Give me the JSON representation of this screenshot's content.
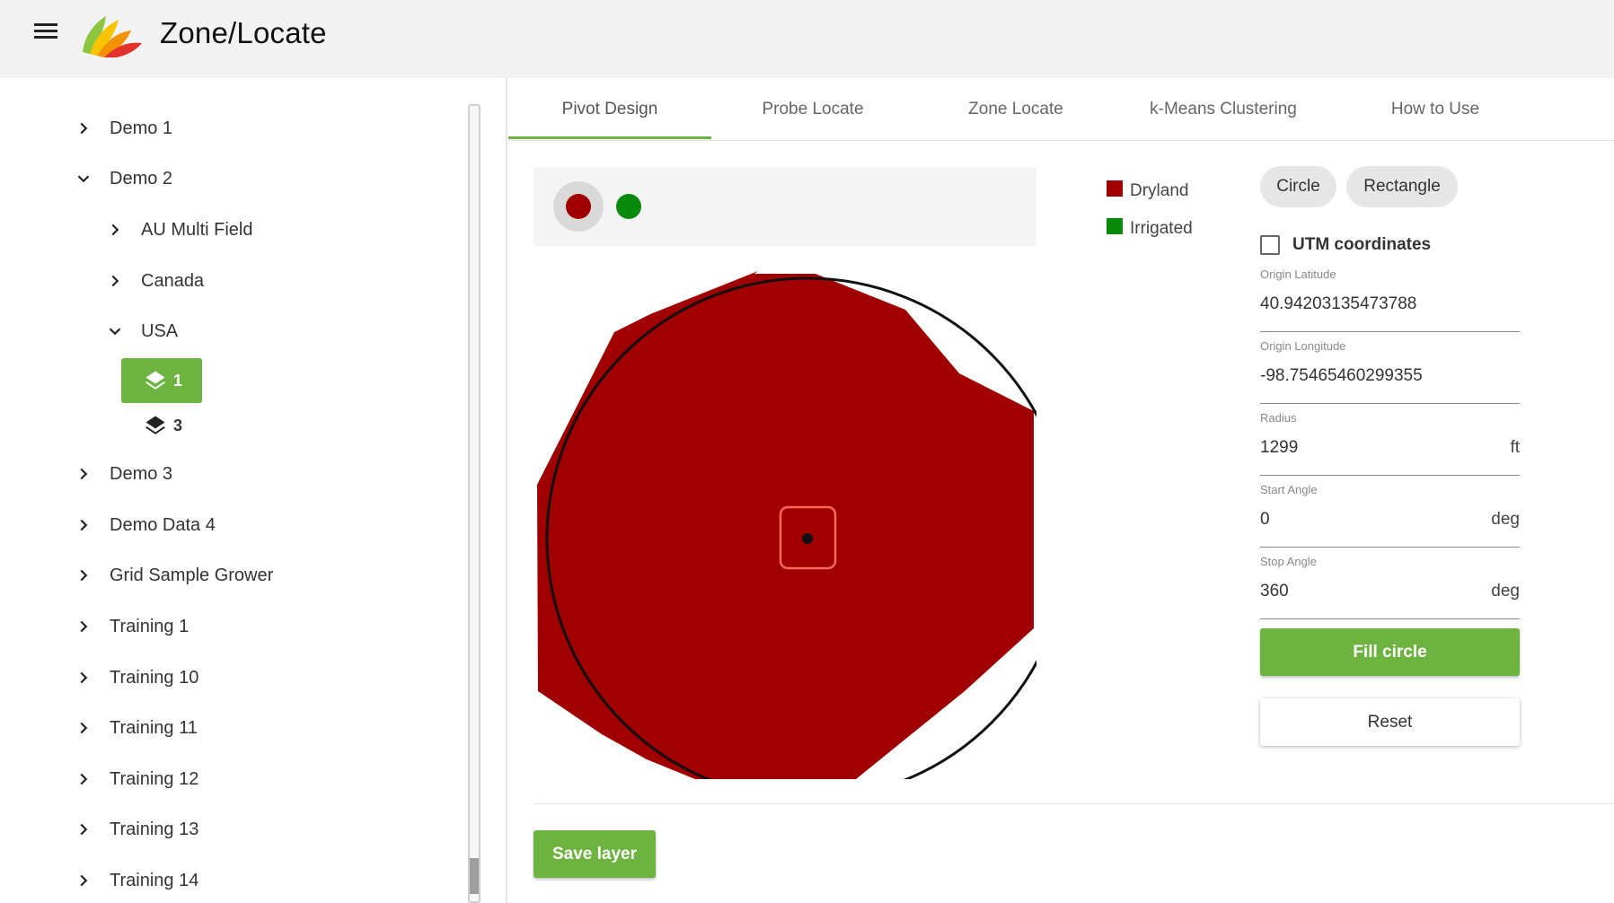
{
  "app": {
    "title": "Zone/Locate",
    "menu_icon": "hamburger-menu-icon",
    "logo_icon": "leaf-fan-logo-icon"
  },
  "sidebar": {
    "items": [
      {
        "label": "Demo 1",
        "expanded": false
      },
      {
        "label": "Demo 2",
        "expanded": true
      },
      {
        "label": "AU Multi Field",
        "expanded": false
      },
      {
        "label": "Canada",
        "expanded": false
      },
      {
        "label": "USA",
        "expanded": true
      },
      {
        "label": "1",
        "selected": true,
        "icon": "layers-icon"
      },
      {
        "label": "3",
        "selected": false,
        "icon": "layers-icon"
      },
      {
        "label": "Demo 3",
        "expanded": false
      },
      {
        "label": "Demo Data 4",
        "expanded": false
      },
      {
        "label": "Grid Sample Grower",
        "expanded": false
      },
      {
        "label": "Training 1",
        "expanded": false
      },
      {
        "label": "Training 10",
        "expanded": false
      },
      {
        "label": "Training 11",
        "expanded": false
      },
      {
        "label": "Training 12",
        "expanded": false
      },
      {
        "label": "Training 13",
        "expanded": false
      },
      {
        "label": "Training 14",
        "expanded": false
      }
    ]
  },
  "tabs": [
    {
      "label": "Pivot Design",
      "active": true
    },
    {
      "label": "Probe Locate",
      "active": false
    },
    {
      "label": "Zone Locate",
      "active": false
    },
    {
      "label": "k-Means Clustering",
      "active": false
    },
    {
      "label": "How to Use",
      "active": false
    }
  ],
  "colors": {
    "accent": "#6db33f",
    "dryland": "#a00000",
    "irrigated": "#0a8a0a"
  },
  "swatches": [
    {
      "name": "dryland",
      "color": "#a00000",
      "selected": true
    },
    {
      "name": "irrigated",
      "color": "#0a8a0a",
      "selected": false
    }
  ],
  "legend": [
    {
      "label": "Dryland",
      "color": "#a00000"
    },
    {
      "label": "Irrigated",
      "color": "#0a8a0a"
    }
  ],
  "shape_buttons": {
    "circle": "Circle",
    "rectangle": "Rectangle"
  },
  "utm": {
    "label": "UTM coordinates",
    "checked": false
  },
  "fields": {
    "origin_latitude": {
      "label": "Origin Latitude",
      "value": "40.94203135473788",
      "unit": ""
    },
    "origin_longitude": {
      "label": "Origin Longitude",
      "value": "-98.75465460299355",
      "unit": ""
    },
    "radius": {
      "label": "Radius",
      "value": "1299",
      "unit": "ft"
    },
    "start_angle": {
      "label": "Start Angle",
      "value": "0",
      "unit": "deg"
    },
    "stop_angle": {
      "label": "Stop Angle",
      "value": "360",
      "unit": "deg"
    }
  },
  "buttons": {
    "fill_circle": "Fill circle",
    "reset": "Reset",
    "save_layer": "Save layer"
  }
}
